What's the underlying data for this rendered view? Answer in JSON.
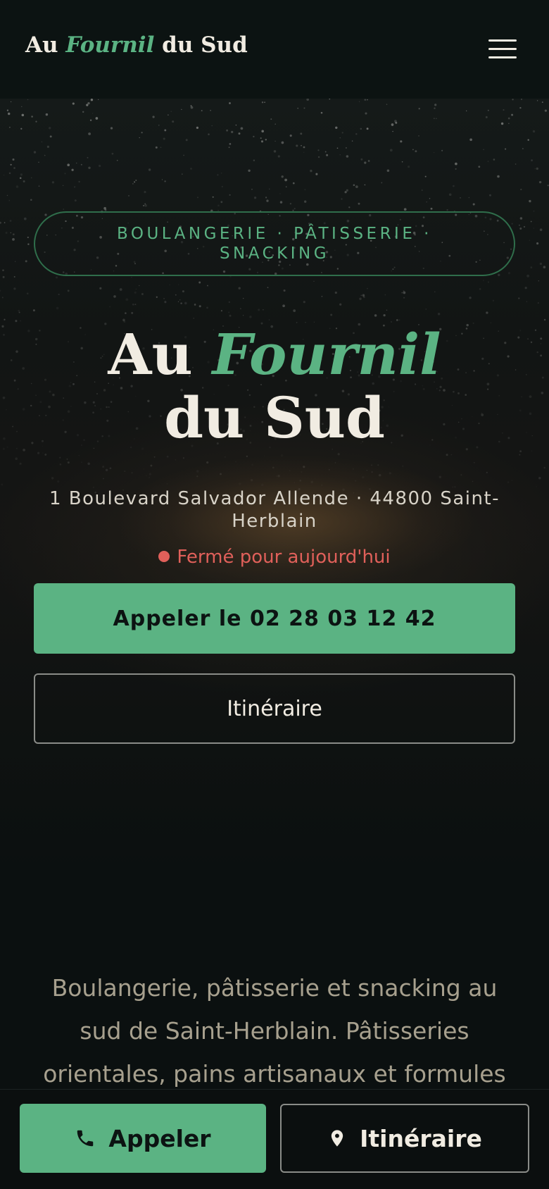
{
  "header": {
    "brand_prefix": "Au",
    "brand_highlight": "Fournil",
    "brand_suffix": "du Sud",
    "menu_icon": "hamburger-icon"
  },
  "hero": {
    "tagline": "BOULANGERIE · PÂTISSERIE · SNACKING",
    "title_line1_prefix": "Au",
    "title_line1_highlight": "Fournil",
    "title_line2": "du Sud",
    "address": "1 Boulevard Salvador Allende · 44800 Saint-Herblain",
    "status": "Fermé pour aujourd'hui",
    "call_button": "Appeler le 02 28 03 12 42",
    "route_button": "Itinéraire"
  },
  "intro": {
    "text": "Boulangerie, pâtisserie et snacking au sud de Saint-Herblain. Pâtisseries orientales, pains artisanaux et formules"
  },
  "bottom_bar": {
    "call_label": "Appeler",
    "call_icon": "phone-icon",
    "route_label": "Itinéraire",
    "route_icon": "map-pin-icon"
  },
  "colors": {
    "accent": "#5bb383",
    "status_closed": "#e0605a",
    "background": "#0b1010",
    "text": "#f1ece2"
  }
}
